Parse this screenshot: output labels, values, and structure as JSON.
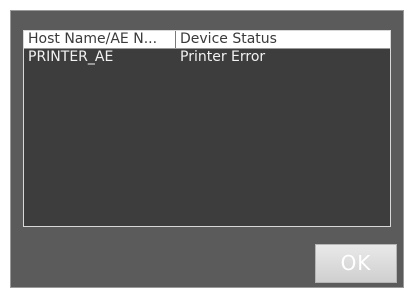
{
  "device_list": {
    "columns": [
      "Host Name/AE N...",
      "Device Status"
    ],
    "rows": [
      {
        "host_name": "PRINTER_AE",
        "status": "Printer Error"
      }
    ]
  },
  "actions": {
    "ok_label": "OK"
  }
}
